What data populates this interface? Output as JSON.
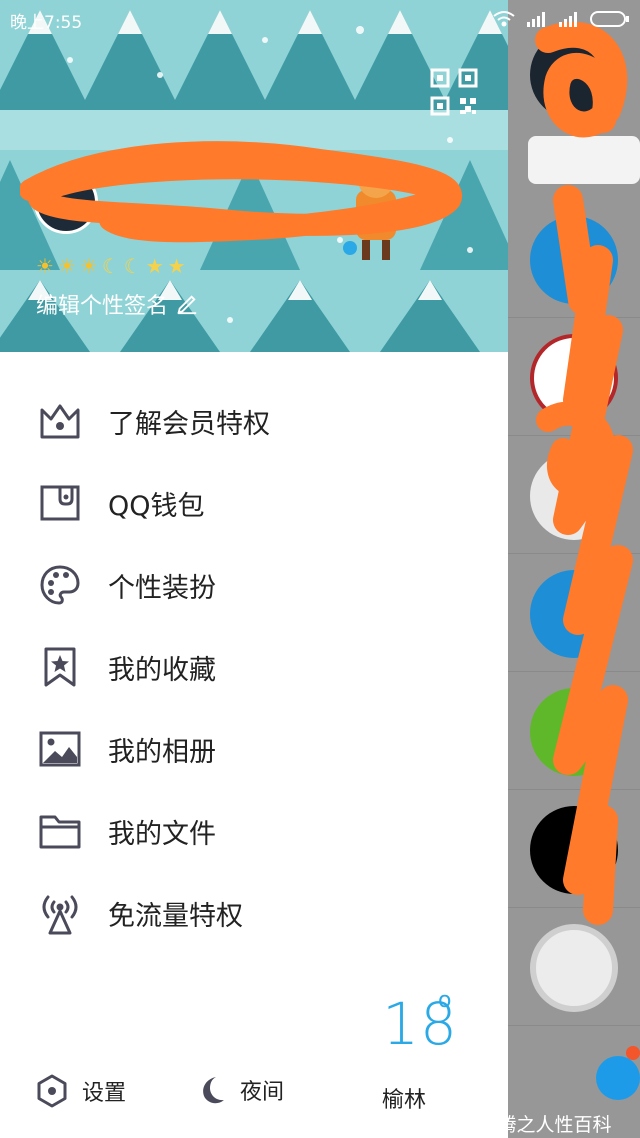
{
  "status_bar": {
    "time": "晚上7:55"
  },
  "header": {
    "signature": "编辑个性签名",
    "level_icons": [
      "sun",
      "sun",
      "sun",
      "moon",
      "moon",
      "star",
      "star"
    ],
    "colors": {
      "sky": "#8fd3d6",
      "tree": "#3f9aa3",
      "snow": "#f2f7f7"
    }
  },
  "menu": {
    "items": [
      {
        "label": "了解会员特权",
        "icon": "crown-icon"
      },
      {
        "label": "QQ钱包",
        "icon": "wallet-icon"
      },
      {
        "label": "个性装扮",
        "icon": "palette-icon"
      },
      {
        "label": "我的收藏",
        "icon": "bookmark-star-icon"
      },
      {
        "label": "我的相册",
        "icon": "photo-icon"
      },
      {
        "label": "我的文件",
        "icon": "folder-icon"
      },
      {
        "label": "免流量特权",
        "icon": "antenna-icon"
      }
    ]
  },
  "footer": {
    "settings_label": "设置",
    "night_label": "夜间",
    "weather": {
      "temperature": "18",
      "unit": "o",
      "city": "榆林"
    }
  },
  "watermark": "头条号 / 大漠狼图腾之人性百科",
  "colors": {
    "accent": "#2aa9e6",
    "icon": "#4a4a5a",
    "scribble": "#ff7a2a",
    "overlay": "#979797"
  }
}
